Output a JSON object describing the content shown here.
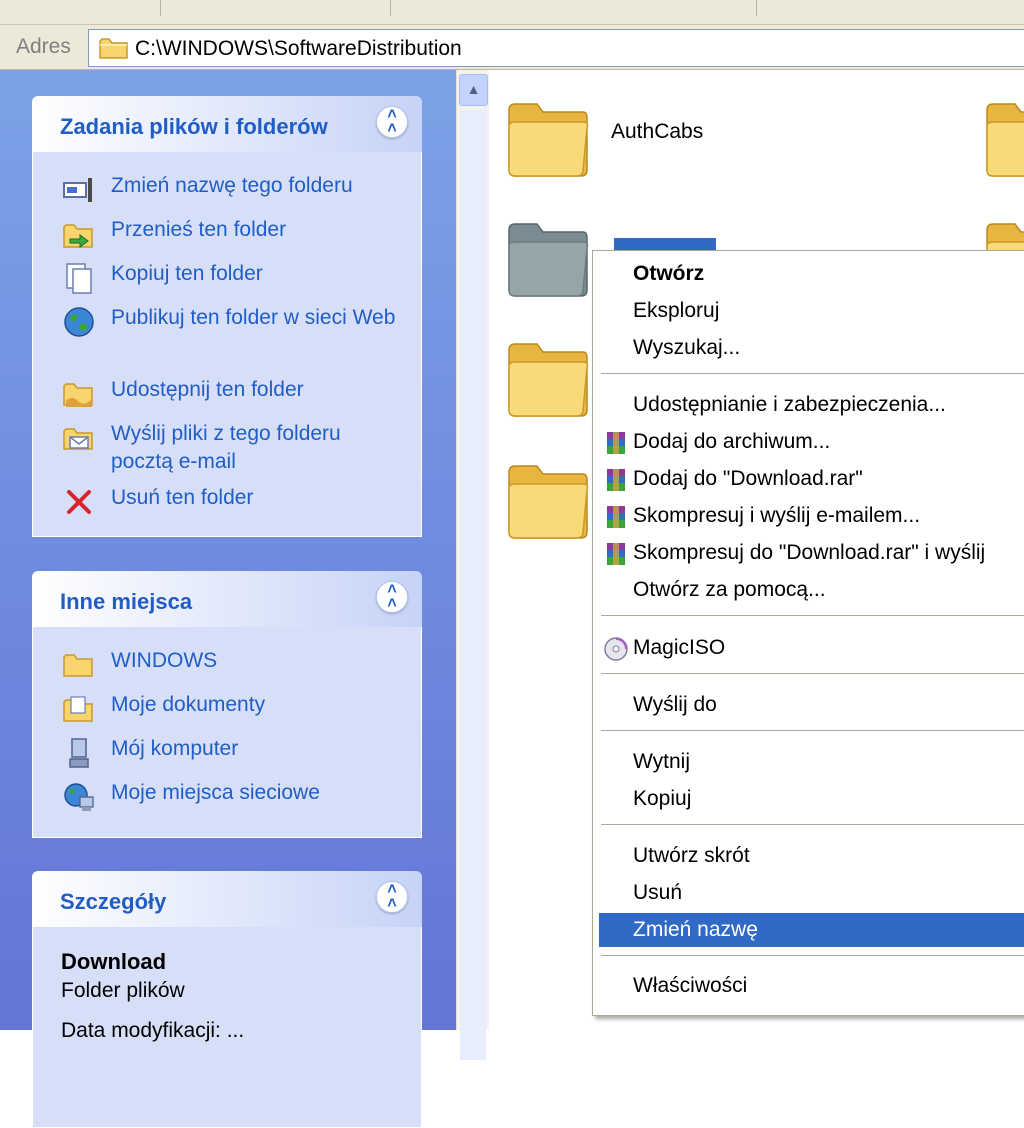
{
  "address": {
    "label": "Adres",
    "path": "C:\\WINDOWS\\SoftwareDistribution"
  },
  "panels": {
    "tasks": {
      "title": "Zadania plików i folderów",
      "items": [
        {
          "label": "Zmień nazwę tego folderu",
          "icon": "rename-icon"
        },
        {
          "label": "Przenieś ten folder",
          "icon": "move-folder-icon"
        },
        {
          "label": "Kopiuj ten folder",
          "icon": "copy-icon"
        },
        {
          "label": "Publikuj ten folder w sieci Web",
          "icon": "globe-icon"
        },
        {
          "label": "Udostępnij ten folder",
          "icon": "share-folder-icon"
        },
        {
          "label": "Wyślij pliki z tego folderu pocztą e-mail",
          "icon": "email-icon"
        },
        {
          "label": "Usuń ten folder",
          "icon": "delete-icon"
        }
      ]
    },
    "places": {
      "title": "Inne miejsca",
      "items": [
        {
          "label": "WINDOWS",
          "icon": "folder-icon"
        },
        {
          "label": "Moje dokumenty",
          "icon": "my-documents-icon"
        },
        {
          "label": "Mój komputer",
          "icon": "my-computer-icon"
        },
        {
          "label": "Moje miejsca sieciowe",
          "icon": "network-places-icon"
        }
      ]
    },
    "details": {
      "title": "Szczegóły",
      "name": "Download",
      "type": "Folder plików",
      "date_partial": "Data modyfikacji: ..."
    }
  },
  "content": {
    "folders": [
      {
        "label": "AuthCabs"
      }
    ]
  },
  "context_menu": {
    "items": [
      {
        "label": "Otwórz",
        "bold": true
      },
      {
        "label": "Eksploruj"
      },
      {
        "label": "Wyszukaj..."
      },
      {
        "label": "Udostępnianie i zabezpieczenia..."
      },
      {
        "label": "Dodaj do archiwum...",
        "icon": "winrar-icon"
      },
      {
        "label": "Dodaj do \"Download.rar\"",
        "icon": "winrar-icon"
      },
      {
        "label": "Skompresuj i wyślij e-mailem...",
        "icon": "winrar-icon"
      },
      {
        "label": "Skompresuj do \"Download.rar\" i wyślij",
        "icon": "winrar-icon"
      },
      {
        "label": "Otwórz za pomocą..."
      },
      {
        "label": "MagicISO",
        "icon": "magiciso-icon"
      },
      {
        "label": "Wyślij do"
      },
      {
        "label": "Wytnij"
      },
      {
        "label": "Kopiuj"
      },
      {
        "label": "Utwórz skrót"
      },
      {
        "label": "Usuń"
      },
      {
        "label": "Zmień nazwę",
        "active": true
      },
      {
        "label": "Właściwości"
      }
    ]
  },
  "colors": {
    "taskpane_bg": "#6375d6",
    "link_blue": "#215dc6",
    "selection": "#316ac5",
    "folder_yellow": "#f7d46e"
  }
}
